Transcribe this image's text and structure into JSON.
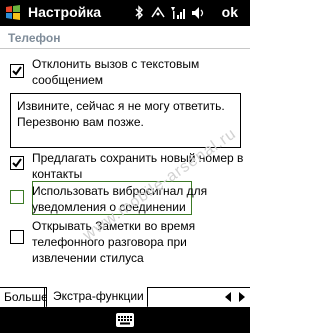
{
  "window": {
    "title": "Настройка",
    "ok_label": "ok"
  },
  "section": {
    "title": "Телефон"
  },
  "options": [
    {
      "line1": "Отклонить вызов с текстовым",
      "line2": "сообщением",
      "line3": "",
      "checked": true
    },
    {
      "line1": "Предлагать сохранить новый номер в",
      "line2": "контакты",
      "line3": "",
      "checked": true
    },
    {
      "line1": "Использовать вибросигнал для",
      "line2": "уведомления о соединении",
      "line3": "",
      "checked": false
    },
    {
      "line1": "Открывать Заметки во время",
      "line2": "телефонного разговора при",
      "line3": "извлечении стилуса",
      "checked": false
    }
  ],
  "message": {
    "value": "Извините, сейчас я не могу ответить.\nПерезвоню вам позже."
  },
  "watermark": "www.mobile-arsenal.ru",
  "tabs": {
    "items": [
      {
        "label": "Больше"
      },
      {
        "label": "Экстра-функции"
      }
    ],
    "active": 1
  },
  "icons": {
    "start": "windows-flag-icon",
    "status": [
      "bluetooth-icon",
      "connectivity-icon",
      "signal-icon",
      "speaker-icon"
    ],
    "keyboard": "keyboard-icon"
  }
}
